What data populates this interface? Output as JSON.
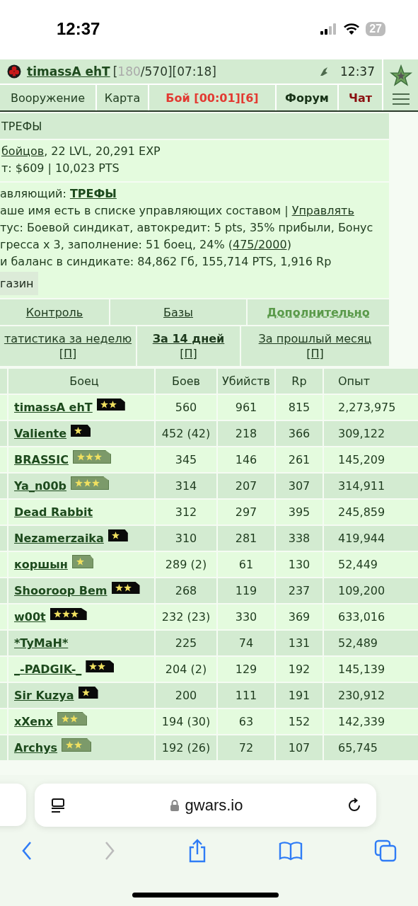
{
  "status_bar": {
    "time": "12:37",
    "battery": "27"
  },
  "header": {
    "player": "timassA ehT",
    "bracket_open": "[",
    "hp": "180",
    "hp_rest": "/570][07:18]",
    "time": "12:37"
  },
  "nav": [
    {
      "label": "Вооружение",
      "kind": "plain"
    },
    {
      "label": "Карта",
      "kind": "plain"
    },
    {
      "label": "Бой [00:01][6]",
      "kind": "alert"
    },
    {
      "label": "Форум",
      "kind": "bold"
    },
    {
      "label": "Чат",
      "kind": "chat"
    }
  ],
  "syndicate": {
    "title": "ТРЕФЫ",
    "members_link": " бойцов",
    "members_rest": ", 22 LVL, 20,291 EXP",
    "funds": "т: $609 | 10,023 PTS",
    "leader_label": "авляющий: ",
    "leader": "ТРЕФЫ",
    "manage_text": "аше имя есть в списке управляющих составом | ",
    "manage_link": "Управлять",
    "status": "тус: Боевой синдикат, автокредит: 5 pts, 35% прибыли, Бонус",
    "fill_text": "гресса x 3, заполнение: 51 боец, 24% (",
    "fill_link": "475/2000",
    "fill_end": ")",
    "balance": "и баланс в синдикате: 84,862 Гб, 155,714 PTS, 1,916 Rp",
    "shop_button": "газин"
  },
  "sections": [
    {
      "label": "Контроль",
      "selected": false
    },
    {
      "label": "Базы",
      "selected": false
    },
    {
      "label": "Дополнительно",
      "selected": true
    }
  ],
  "periods": [
    {
      "label": "татистика за неделю",
      "bracket_open": "[",
      "link": "П",
      "bracket_close": "]",
      "selected": false
    },
    {
      "label": "За 14 дней",
      "bracket_open": "[",
      "link": "П",
      "bracket_close": "]",
      "selected": true
    },
    {
      "label": "За прошлый месяц",
      "bracket_open": "[",
      "link": "П",
      "bracket_close": "]",
      "selected": false
    }
  ],
  "table": {
    "columns": [
      "Боец",
      "Боев",
      "Убийств",
      "Rp",
      "Опыт"
    ],
    "rows": [
      {
        "name": "timassA ehT",
        "badge": {
          "kind": "dark2"
        },
        "battles": "560",
        "kills": "961",
        "rp": "815",
        "exp": "2,273,975"
      },
      {
        "name": "Valiente",
        "badge": {
          "kind": "dark1"
        },
        "battles": "452 (42)",
        "kills": "218",
        "rp": "366",
        "exp": "309,122"
      },
      {
        "name": "BRASSIC",
        "badge": {
          "kind": "olive3"
        },
        "battles": "345",
        "kills": "146",
        "rp": "261",
        "exp": "145,209"
      },
      {
        "name": "Ya_n00b",
        "badge": {
          "kind": "olive3"
        },
        "battles": "314",
        "kills": "207",
        "rp": "307",
        "exp": "314,911"
      },
      {
        "name": "Dead Rabbit",
        "battles": "312",
        "kills": "297",
        "rp": "395",
        "exp": "245,859"
      },
      {
        "name": "Nezamerzaika",
        "badge": {
          "kind": "dark1"
        },
        "battles": "310",
        "kills": "281",
        "rp": "338",
        "exp": "419,944"
      },
      {
        "name": "коршын",
        "badge": {
          "kind": "olive1"
        },
        "battles": "289 (2)",
        "kills": "61",
        "rp": "130",
        "exp": "52,449"
      },
      {
        "name": "Shooroop Bem",
        "badge": {
          "kind": "dark2"
        },
        "battles": "268",
        "kills": "119",
        "rp": "237",
        "exp": "109,200"
      },
      {
        "name": "w00t",
        "badge": {
          "kind": "dark3"
        },
        "battles": "232 (23)",
        "kills": "330",
        "rp": "369",
        "exp": "633,016"
      },
      {
        "name": "*TyMaH*",
        "battles": "225",
        "kills": "74",
        "rp": "131",
        "exp": "52,489"
      },
      {
        "name": "_-PADGIK-_",
        "badge": {
          "kind": "dark2"
        },
        "battles": "204 (2)",
        "kills": "129",
        "rp": "192",
        "exp": "145,139"
      },
      {
        "name": "Sir Kuzya",
        "badge": {
          "kind": "dark1"
        },
        "battles": "200",
        "kills": "111",
        "rp": "191",
        "exp": "230,912"
      },
      {
        "name": "xXenx",
        "badge": {
          "kind": "olive2"
        },
        "battles": "194 (30)",
        "kills": "63",
        "rp": "152",
        "exp": "142,339"
      },
      {
        "name": "Archys",
        "badge": {
          "kind": "olive2"
        },
        "battles": "192 (26)",
        "kills": "72",
        "rp": "107",
        "exp": "65,745"
      }
    ]
  },
  "browser": {
    "url": "gwars.io"
  }
}
